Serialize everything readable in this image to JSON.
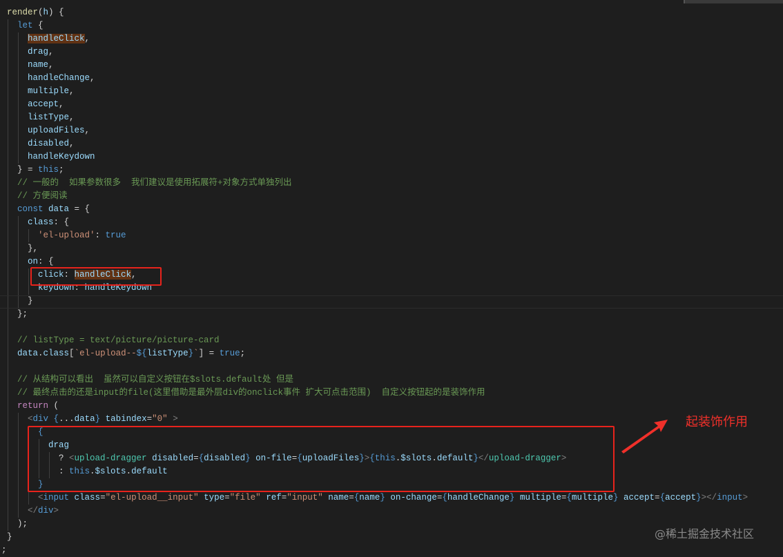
{
  "colors": {
    "background": "#1e1e1e",
    "annotation": "#e8231c",
    "highlight": "#613214"
  },
  "annotation": {
    "label": "起装饰作用",
    "watermark": "@稀土掘金技术社区"
  },
  "lines": [
    {
      "i": 0,
      "t": [
        [
          "f",
          "render"
        ],
        [
          "p",
          "("
        ],
        [
          "v",
          "h"
        ],
        [
          "p",
          ") {"
        ]
      ]
    },
    {
      "i": 1,
      "t": [
        [
          "k",
          "let"
        ],
        [
          "p",
          " {"
        ]
      ]
    },
    {
      "i": 2,
      "t": [
        [
          "v",
          "handleClick",
          "hl"
        ],
        [
          "p",
          ","
        ]
      ]
    },
    {
      "i": 2,
      "t": [
        [
          "v",
          "drag"
        ],
        [
          "p",
          ","
        ]
      ]
    },
    {
      "i": 2,
      "t": [
        [
          "v",
          "name"
        ],
        [
          "p",
          ","
        ]
      ]
    },
    {
      "i": 2,
      "t": [
        [
          "v",
          "handleChange"
        ],
        [
          "p",
          ","
        ]
      ]
    },
    {
      "i": 2,
      "t": [
        [
          "v",
          "multiple"
        ],
        [
          "p",
          ","
        ]
      ]
    },
    {
      "i": 2,
      "t": [
        [
          "v",
          "accept"
        ],
        [
          "p",
          ","
        ]
      ]
    },
    {
      "i": 2,
      "t": [
        [
          "v",
          "listType"
        ],
        [
          "p",
          ","
        ]
      ]
    },
    {
      "i": 2,
      "t": [
        [
          "v",
          "uploadFiles"
        ],
        [
          "p",
          ","
        ]
      ]
    },
    {
      "i": 2,
      "t": [
        [
          "v",
          "disabled"
        ],
        [
          "p",
          ","
        ]
      ]
    },
    {
      "i": 2,
      "t": [
        [
          "v",
          "handleKeydown"
        ]
      ]
    },
    {
      "i": 1,
      "t": [
        [
          "p",
          "} = "
        ],
        [
          "k",
          "this"
        ],
        [
          "p",
          ";"
        ]
      ]
    },
    {
      "i": 1,
      "t": [
        [
          "c",
          "// 一般的  如果参数很多  我们建议是使用拓展符+对象方式单独列出"
        ]
      ]
    },
    {
      "i": 1,
      "t": [
        [
          "c",
          "// 方便阅读"
        ]
      ]
    },
    {
      "i": 1,
      "t": [
        [
          "k",
          "const"
        ],
        [
          "p",
          " "
        ],
        [
          "v",
          "data"
        ],
        [
          "p",
          " = {"
        ]
      ]
    },
    {
      "i": 2,
      "t": [
        [
          "v",
          "class"
        ],
        [
          "p",
          ": {"
        ]
      ]
    },
    {
      "i": 3,
      "t": [
        [
          "s",
          "'el-upload'"
        ],
        [
          "p",
          ": "
        ],
        [
          "k",
          "true"
        ]
      ]
    },
    {
      "i": 2,
      "t": [
        [
          "p",
          "},"
        ]
      ]
    },
    {
      "i": 2,
      "t": [
        [
          "v",
          "on"
        ],
        [
          "p",
          ": {"
        ]
      ]
    },
    {
      "i": 3,
      "t": [
        [
          "v",
          "click"
        ],
        [
          "p",
          ": "
        ],
        [
          "v",
          "handleClick",
          "hl"
        ],
        [
          "p",
          ","
        ]
      ]
    },
    {
      "i": 3,
      "t": [
        [
          "v",
          "keydown"
        ],
        [
          "p",
          ": "
        ],
        [
          "v",
          "handleKeydown"
        ]
      ]
    },
    {
      "i": 2,
      "t": [
        [
          "p",
          "}"
        ]
      ]
    },
    {
      "i": 1,
      "t": [
        [
          "p",
          "};"
        ]
      ]
    },
    {
      "i": 1,
      "t": []
    },
    {
      "i": 1,
      "t": [
        [
          "c",
          "// listType = text/picture/picture-card"
        ]
      ]
    },
    {
      "i": 1,
      "t": [
        [
          "v",
          "data"
        ],
        [
          "p",
          "."
        ],
        [
          "v",
          "class"
        ],
        [
          "p",
          "["
        ],
        [
          "s",
          "`el-upload--"
        ],
        [
          "k",
          "${"
        ],
        [
          "v",
          "listType"
        ],
        [
          "k",
          "}"
        ],
        [
          "s",
          "`"
        ],
        [
          "p",
          "] = "
        ],
        [
          "k",
          "true"
        ],
        [
          "p",
          ";"
        ]
      ]
    },
    {
      "i": 1,
      "t": []
    },
    {
      "i": 1,
      "t": [
        [
          "c",
          "// 从结构可以看出  虽然可以自定义按钮在$slots.default处 但是"
        ]
      ]
    },
    {
      "i": 1,
      "t": [
        [
          "c",
          "// 最终点击的还是input的file(这里借助是最外层div的onclick事件 扩大可点击范围)  自定义按钮起的是装饰作用"
        ]
      ]
    },
    {
      "i": 1,
      "t": [
        [
          "r",
          "return"
        ],
        [
          "p",
          " ("
        ]
      ]
    },
    {
      "i": 2,
      "t": [
        [
          "g",
          "<"
        ],
        [
          "k",
          "div"
        ],
        [
          "p",
          " "
        ],
        [
          "k",
          "{"
        ],
        [
          "p",
          "..."
        ],
        [
          "v",
          "data"
        ],
        [
          "k",
          "}"
        ],
        [
          "p",
          " "
        ],
        [
          "v",
          "tabindex"
        ],
        [
          "p",
          "="
        ],
        [
          "s",
          "\"0\""
        ],
        [
          "p",
          " "
        ],
        [
          "g",
          ">"
        ]
      ]
    },
    {
      "i": 3,
      "t": [
        [
          "k",
          "{"
        ]
      ]
    },
    {
      "i": 4,
      "t": [
        [
          "v",
          "drag"
        ]
      ]
    },
    {
      "i": 5,
      "t": [
        [
          "p",
          "? "
        ],
        [
          "g",
          "<"
        ],
        [
          "cm",
          "upload-dragger"
        ],
        [
          "p",
          " "
        ],
        [
          "v",
          "disabled"
        ],
        [
          "p",
          "="
        ],
        [
          "k",
          "{"
        ],
        [
          "v",
          "disabled"
        ],
        [
          "k",
          "}"
        ],
        [
          "p",
          " "
        ],
        [
          "v",
          "on-file"
        ],
        [
          "p",
          "="
        ],
        [
          "k",
          "{"
        ],
        [
          "v",
          "uploadFiles"
        ],
        [
          "k",
          "}"
        ],
        [
          "g",
          ">"
        ],
        [
          "k",
          "{this"
        ],
        [
          "p",
          "."
        ],
        [
          "v",
          "$slots"
        ],
        [
          "p",
          "."
        ],
        [
          "v",
          "default"
        ],
        [
          "k",
          "}"
        ],
        [
          "g",
          "</"
        ],
        [
          "cm",
          "upload-dragger"
        ],
        [
          "g",
          ">"
        ]
      ]
    },
    {
      "i": 5,
      "t": [
        [
          "p",
          ": "
        ],
        [
          "k",
          "this"
        ],
        [
          "p",
          "."
        ],
        [
          "v",
          "$slots"
        ],
        [
          "p",
          "."
        ],
        [
          "v",
          "default"
        ]
      ]
    },
    {
      "i": 3,
      "t": [
        [
          "k",
          "}"
        ]
      ]
    },
    {
      "i": 3,
      "t": [
        [
          "g",
          "<"
        ],
        [
          "k",
          "input"
        ],
        [
          "p",
          " "
        ],
        [
          "v",
          "class"
        ],
        [
          "p",
          "="
        ],
        [
          "s",
          "\"el-upload__input\""
        ],
        [
          "p",
          " "
        ],
        [
          "v",
          "type"
        ],
        [
          "p",
          "="
        ],
        [
          "s",
          "\"file\""
        ],
        [
          "p",
          " "
        ],
        [
          "v",
          "ref"
        ],
        [
          "p",
          "="
        ],
        [
          "s",
          "\"input\""
        ],
        [
          "p",
          " "
        ],
        [
          "v",
          "name"
        ],
        [
          "p",
          "="
        ],
        [
          "k",
          "{"
        ],
        [
          "v",
          "name"
        ],
        [
          "k",
          "}"
        ],
        [
          "p",
          " "
        ],
        [
          "v",
          "on-change"
        ],
        [
          "p",
          "="
        ],
        [
          "k",
          "{"
        ],
        [
          "v",
          "handleChange"
        ],
        [
          "k",
          "}"
        ],
        [
          "p",
          " "
        ],
        [
          "v",
          "multiple"
        ],
        [
          "p",
          "="
        ],
        [
          "k",
          "{"
        ],
        [
          "v",
          "multiple"
        ],
        [
          "k",
          "}"
        ],
        [
          "p",
          " "
        ],
        [
          "v",
          "accept"
        ],
        [
          "p",
          "="
        ],
        [
          "k",
          "{"
        ],
        [
          "v",
          "accept"
        ],
        [
          "k",
          "}"
        ],
        [
          "g",
          "></"
        ],
        [
          "k",
          "input"
        ],
        [
          "g",
          ">"
        ]
      ]
    },
    {
      "i": 2,
      "t": [
        [
          "g",
          "</"
        ],
        [
          "k",
          "div"
        ],
        [
          "g",
          ">"
        ]
      ]
    },
    {
      "i": 1,
      "t": [
        [
          "p",
          ");"
        ]
      ]
    },
    {
      "i": 0,
      "t": [
        [
          "p",
          "}"
        ]
      ]
    },
    {
      "i": -1,
      "t": [
        [
          "p",
          ";"
        ]
      ]
    }
  ]
}
